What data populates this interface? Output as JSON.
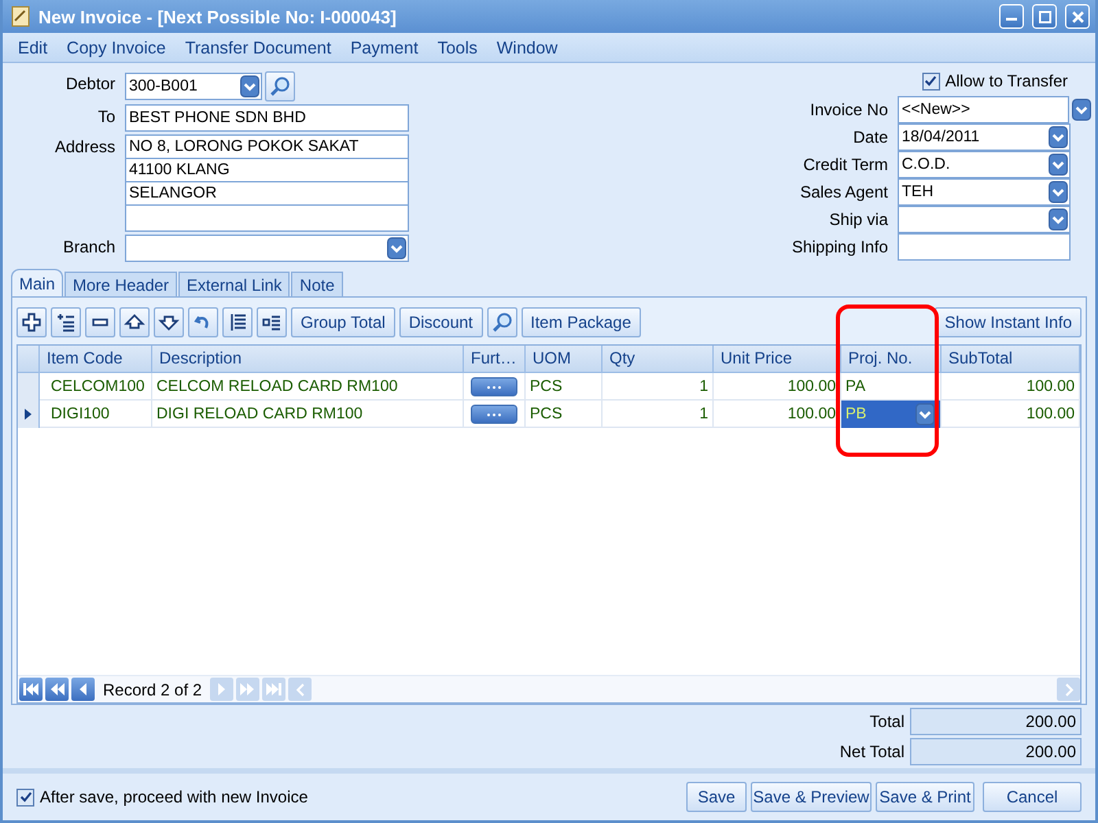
{
  "window": {
    "title": "New Invoice - [Next Possible No: I-000043]"
  },
  "menu": [
    "Edit",
    "Copy Invoice",
    "Transfer Document",
    "Payment",
    "Tools",
    "Window"
  ],
  "debtor": {
    "label": "Debtor",
    "value": "300-B001"
  },
  "to": {
    "label": "To",
    "value": "BEST PHONE SDN BHD"
  },
  "address": {
    "label": "Address",
    "lines": [
      "NO 8, LORONG POKOK SAKAT",
      "41100 KLANG",
      "SELANGOR"
    ]
  },
  "branch": {
    "label": "Branch"
  },
  "allow_transfer": {
    "label": "Allow to Transfer",
    "checked": true
  },
  "fields": [
    {
      "label": "Invoice No",
      "value": "<<New>>",
      "kind": "combo"
    },
    {
      "label": "Date",
      "value": "18/04/2011",
      "kind": "dropdown"
    },
    {
      "label": "Credit Term",
      "value": "C.O.D.",
      "kind": "dropdown"
    },
    {
      "label": "Sales Agent",
      "value": "TEH",
      "kind": "dropdown"
    },
    {
      "label": "Ship via",
      "kind": "dropdown"
    },
    {
      "label": "Shipping Info",
      "kind": "text"
    }
  ],
  "tabs": [
    {
      "label": "Main",
      "selected": true
    },
    {
      "label": "More Header",
      "selected": false
    },
    {
      "label": "External Link",
      "selected": false
    },
    {
      "label": "Note",
      "selected": false
    }
  ],
  "toolbar": {
    "buttons": [
      "Group Total",
      "Discount"
    ],
    "package_button": "Item Package",
    "info_button": "Show Instant Info"
  },
  "grid": {
    "columns": [
      "Item Code",
      "Description",
      "Furt…",
      "UOM",
      "Qty",
      "Unit Price",
      "Proj. No.",
      "SubTotal"
    ],
    "rows": [
      {
        "item_code": "CELCOM100",
        "description": "CELCOM RELOAD CARD RM100",
        "uom": "PCS",
        "qty": "1",
        "unit_price": "100.00",
        "proj_no": "PA",
        "subtotal": "100.00",
        "selected": false
      },
      {
        "item_code": "DIGI100",
        "description": "DIGI RELOAD CARD RM100",
        "uom": "PCS",
        "qty": "1",
        "unit_price": "100.00",
        "proj_no": "PB",
        "subtotal": "100.00",
        "selected": true
      }
    ]
  },
  "navigator": {
    "text": "Record 2 of 2"
  },
  "totals": [
    {
      "label": "Total",
      "value": "200.00"
    },
    {
      "label": "Net Total",
      "value": "200.00"
    }
  ],
  "proceed": {
    "label": "After save, proceed with new Invoice",
    "checked": true
  },
  "buttons": [
    "Save",
    "Save & Preview",
    "Save & Print",
    "Cancel"
  ]
}
